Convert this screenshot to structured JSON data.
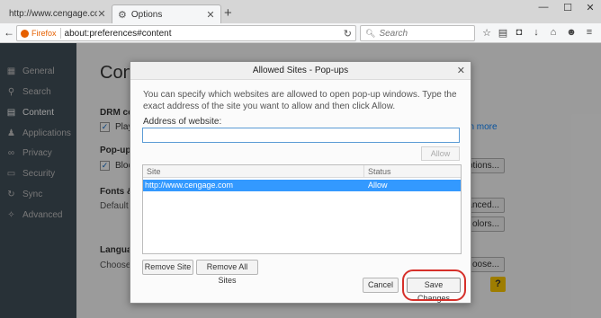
{
  "browser": {
    "tabs": [
      {
        "label": "http://www.cengage.com/us/",
        "active": false
      },
      {
        "label": "Options",
        "active": true
      }
    ],
    "new_tab": "+",
    "window_controls": [
      "—",
      "☐",
      "✕"
    ],
    "identity": "Firefox",
    "url": "about:preferences#content",
    "search_placeholder": "Search"
  },
  "sidebar": {
    "items": [
      {
        "label": "General",
        "icon": "general-icon"
      },
      {
        "label": "Search",
        "icon": "search-icon"
      },
      {
        "label": "Content",
        "icon": "content-icon",
        "active": true
      },
      {
        "label": "Applications",
        "icon": "applications-icon"
      },
      {
        "label": "Privacy",
        "icon": "privacy-icon"
      },
      {
        "label": "Security",
        "icon": "security-icon"
      },
      {
        "label": "Sync",
        "icon": "sync-icon"
      },
      {
        "label": "Advanced",
        "icon": "advanced-icon"
      }
    ]
  },
  "page": {
    "title": "Cont",
    "drm_heading": "DRM co",
    "drm_check": "Play",
    "learn_more": "earn more",
    "popups_heading": "Pop-up",
    "popups_check": "Bloc",
    "exceptions_btn": "eptions...",
    "fonts_heading": "Fonts &",
    "default_font": "Default f",
    "advanced_btn": "vanced...",
    "colors_btn": "olors...",
    "languages_heading": "Languag",
    "choose_text": "Choose y",
    "choose_btn": "oose...",
    "help": "?"
  },
  "dialog": {
    "title": "Allowed Sites - Pop-ups",
    "description": "You can specify which websites are allowed to open pop-up windows. Type the exact address of the site you want to allow and then click Allow.",
    "address_label": "Address of website:",
    "address_value": "",
    "allow_button": "Allow",
    "columns": {
      "site": "Site",
      "status": "Status"
    },
    "rows": [
      {
        "site": "http://www.cengage.com",
        "status": "Allow"
      }
    ],
    "remove_site_button": "Remove Site",
    "remove_all_button": "Remove All Sites",
    "cancel_button": "Cancel",
    "save_button": "Save Changes"
  },
  "colors": {
    "sidebar_bg": "#424f5a",
    "selection": "#3399ff",
    "highlight_ring": "#d6302a",
    "help_badge": "#ffca00"
  }
}
